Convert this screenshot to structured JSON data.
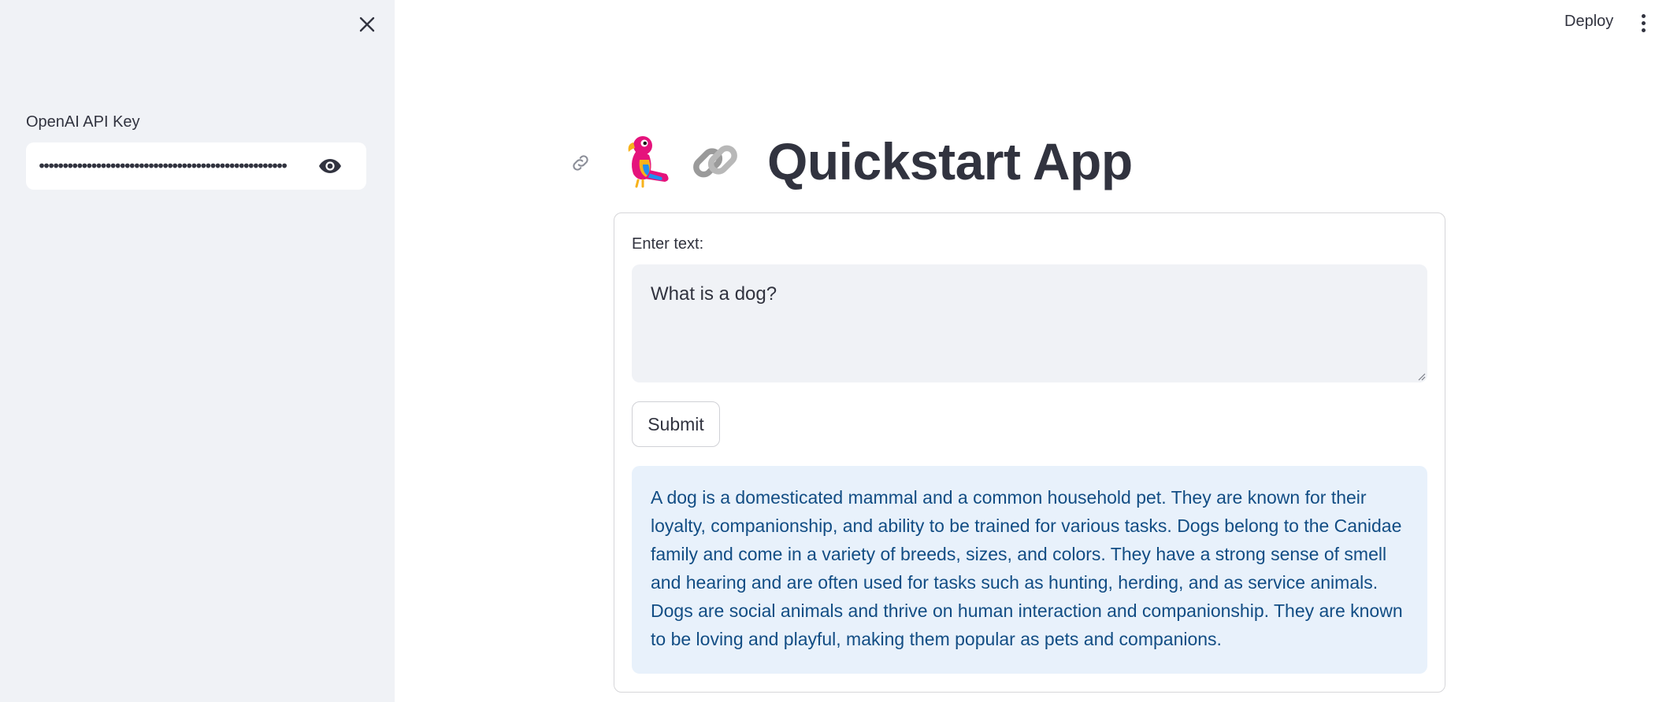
{
  "sidebar": {
    "api_key_label": "OpenAI API Key",
    "api_key_value": "••••••••••••••••••••••••••••••••••••••••••••••••••••"
  },
  "header": {
    "deploy_label": "Deploy"
  },
  "main": {
    "title": "Quickstart App",
    "title_emojis": [
      "parrot",
      "link"
    ],
    "text_label": "Enter text:",
    "text_value": "What is a dog?",
    "submit_label": "Submit",
    "response": "A dog is a domesticated mammal and a common household pet. They are known for their loyalty, companionship, and ability to be trained for various tasks. Dogs belong to the Canidae family and come in a variety of breeds, sizes, and colors. They have a strong sense of smell and hearing and are often used for tasks such as hunting, herding, and as service animals. Dogs are social animals and thrive on human interaction and companionship. They are known to be loving and playful, making them popular as pets and companions."
  },
  "colors": {
    "sidebar_bg": "#f0f2f6",
    "text": "#31333f",
    "info_bg": "#e8f1fb",
    "info_text": "#124d84"
  }
}
